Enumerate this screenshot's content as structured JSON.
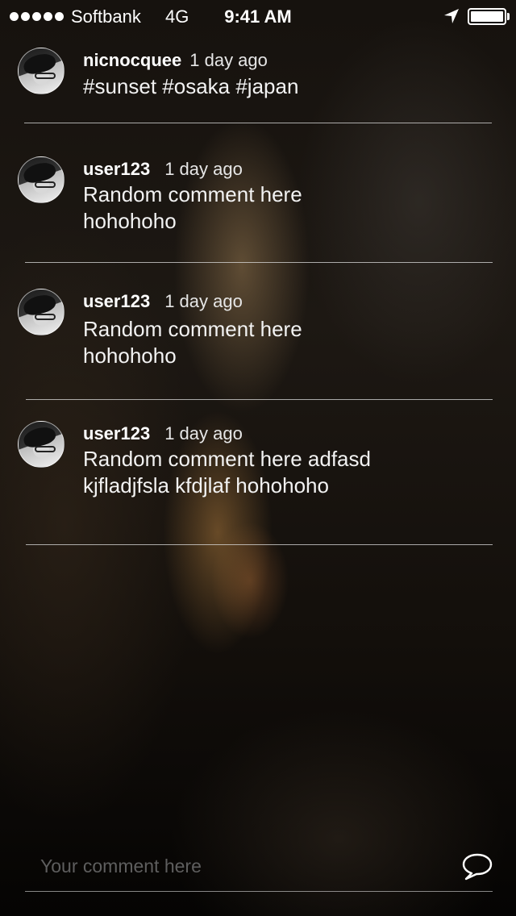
{
  "status_bar": {
    "carrier": "Softbank",
    "network": "4G",
    "time": "9:41 AM",
    "signal_icon": "signal-dots-icon",
    "location_icon": "location-arrow-icon",
    "battery_icon": "battery-icon",
    "battery_level": 1.0
  },
  "comments": [
    {
      "username": "nicnocquee",
      "timestamp": "1 day ago",
      "text": "#sunset #osaka #japan",
      "avatar_icon": "avatar"
    },
    {
      "username": "user123",
      "timestamp": "1 day ago",
      "text": "Random comment here hohohoho",
      "avatar_icon": "avatar"
    },
    {
      "username": "user123",
      "timestamp": "1 day ago",
      "text": "Random comment here hohohoho",
      "avatar_icon": "avatar"
    },
    {
      "username": "user123",
      "timestamp": "1 day ago",
      "text": "Random comment here adfasd kjfladjfsla kfdjlaf hohohoho",
      "avatar_icon": "avatar"
    }
  ],
  "composer": {
    "placeholder": "Your comment here",
    "value": "",
    "send_icon": "speech-bubble-icon"
  },
  "colors": {
    "text": "#ffffff",
    "divider": "#dcdcdc",
    "placeholder": "#5e5e5e"
  }
}
